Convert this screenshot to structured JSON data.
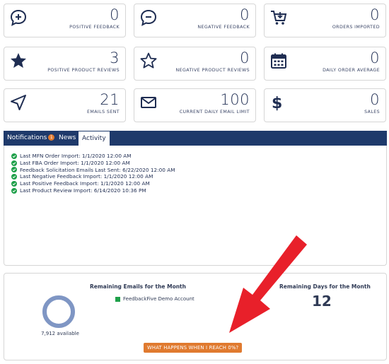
{
  "stats": [
    {
      "icon": "chat-plus-icon",
      "value": "0",
      "label": "POSITIVE FEEDBACK"
    },
    {
      "icon": "chat-minus-icon",
      "value": "0",
      "label": "NEGATIVE FEEDBACK"
    },
    {
      "icon": "cart-icon",
      "value": "0",
      "label": "ORDERS IMPORTED"
    },
    {
      "icon": "star-filled-icon",
      "value": "3",
      "label": "POSITIVE PRODUCT REVIEWS"
    },
    {
      "icon": "star-outline-icon",
      "value": "0",
      "label": "NEGATIVE PRODUCT REVIEWS"
    },
    {
      "icon": "calendar-icon",
      "value": "0",
      "label": "DAILY ORDER AVERAGE"
    },
    {
      "icon": "send-icon",
      "value": "21",
      "label": "EMAILS SENT"
    },
    {
      "icon": "envelope-icon",
      "value": "100",
      "label": "CURRENT DAILY EMAIL LIMIT"
    },
    {
      "icon": "dollar-icon",
      "value": "0",
      "label": "SALES"
    }
  ],
  "tabs": {
    "notifications": "Notifications",
    "notifications_badge": "1",
    "news": "News",
    "activity": "Activity"
  },
  "activity": [
    "Last MFN Order Import: 1/1/2020 12:00 AM",
    "Last FBA Order Import: 1/1/2020 12:00 AM",
    "Feedback Solicitation Emails Last Sent: 6/22/2020 12:00 AM",
    "Last Negative Feedback Import: 1/1/2020 12:00 AM",
    "Last Positive Feedback Import: 1/1/2020 12:00 AM",
    "Last Product Review Import: 6/14/2020 10:36 PM"
  ],
  "remaining_emails": {
    "title": "Remaining Emails for the Month",
    "percent_label": "99%",
    "percent": 99,
    "available": "7,912 available",
    "legend": "FeedbackFive Demo Account"
  },
  "remaining_days": {
    "title": "Remaining Days for the Month",
    "value": "12"
  },
  "cta": {
    "label": "WHAT HAPPENS WHEN I REACH 0%?"
  },
  "colors": {
    "navy": "#1f3a6b",
    "text": "#1f2d52",
    "accent_orange": "#e07a2f",
    "success_green": "#1fa04a",
    "donut_blue": "#7f96c4",
    "arrow_red": "#e8202a"
  }
}
